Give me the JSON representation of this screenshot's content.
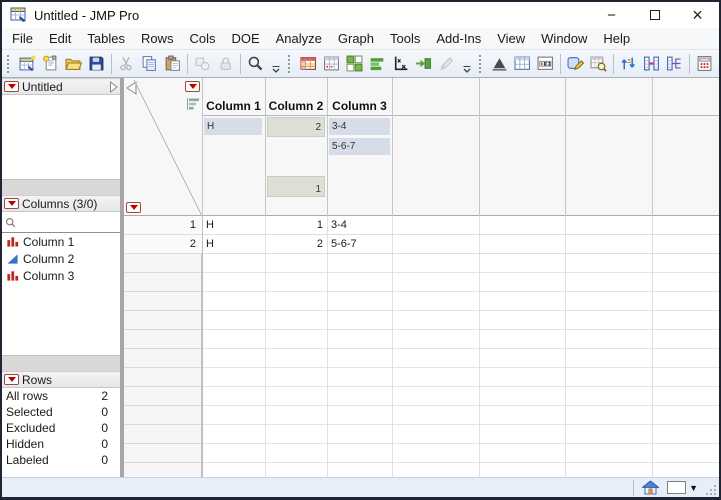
{
  "window": {
    "title": "Untitled - JMP Pro",
    "controls": {
      "minimize": "−",
      "close": "×"
    }
  },
  "menu": {
    "items": [
      "File",
      "Edit",
      "Tables",
      "Rows",
      "Cols",
      "DOE",
      "Analyze",
      "Graph",
      "Tools",
      "Add-Ins",
      "View",
      "Window",
      "Help"
    ]
  },
  "toolbar": {
    "groups": [
      {
        "items": [
          {
            "icon": "new-data-table"
          },
          {
            "icon": "new-journal"
          },
          {
            "icon": "open-file"
          },
          {
            "icon": "save"
          },
          {
            "sep": true
          },
          {
            "icon": "cut",
            "disabled": true
          },
          {
            "icon": "copy"
          },
          {
            "icon": "paste"
          },
          {
            "sep": true
          },
          {
            "icon": "selection",
            "disabled": true
          },
          {
            "icon": "lock",
            "disabled": true
          },
          {
            "sep": true
          },
          {
            "icon": "search"
          }
        ]
      },
      {
        "items": [
          {
            "icon": "data-table"
          },
          {
            "icon": "summary-table"
          },
          {
            "icon": "tile-windows"
          },
          {
            "icon": "bar-chart"
          },
          {
            "icon": "axes"
          },
          {
            "icon": "formula-run"
          },
          {
            "icon": "edit-pen",
            "disabled": true
          }
        ]
      },
      {
        "items": [
          {
            "icon": "distribution"
          },
          {
            "icon": "new-column-grid"
          },
          {
            "icon": "numeric-grid"
          },
          {
            "sep": true
          },
          {
            "icon": "select-edit"
          },
          {
            "icon": "table-preview"
          },
          {
            "sep": true
          },
          {
            "icon": "sort-arrows"
          },
          {
            "icon": "join-columns"
          },
          {
            "icon": "split-columns"
          },
          {
            "sep": true
          },
          {
            "icon": "calculator"
          },
          {
            "icon": "run-script"
          }
        ]
      }
    ]
  },
  "sidebar": {
    "table_panel": {
      "title": "Untitled"
    },
    "columns_panel": {
      "title": "Columns (3/0)",
      "items": [
        {
          "label": "Column 1",
          "type": "nominal"
        },
        {
          "label": "Column 2",
          "type": "continuous"
        },
        {
          "label": "Column 3",
          "type": "nominal"
        }
      ]
    },
    "rows_panel": {
      "title": "Rows",
      "stats": [
        {
          "label": "All rows",
          "value": "2"
        },
        {
          "label": "Selected",
          "value": "0"
        },
        {
          "label": "Excluded",
          "value": "0"
        },
        {
          "label": "Hidden",
          "value": "0"
        },
        {
          "label": "Labeled",
          "value": "0"
        }
      ]
    }
  },
  "grid": {
    "columns": [
      "Column 1",
      "Column 2",
      "Column 3"
    ],
    "header_summary": {
      "col1": [
        {
          "label": "H"
        }
      ],
      "col2": [
        {
          "label": "2"
        },
        {
          "label": "1"
        }
      ],
      "col3": [
        {
          "label": "3-4"
        },
        {
          "label": "5-6-7"
        }
      ]
    },
    "rows": [
      {
        "num": "1",
        "c1": "H",
        "c2": "1",
        "c3": "3-4"
      },
      {
        "num": "2",
        "c1": "H",
        "c2": "2",
        "c3": "5-6-7"
      }
    ]
  },
  "colors": {
    "accent_red": "#c00000",
    "categorical_bar": "#d6dce8",
    "continuous_bar": "#dbdfd6",
    "toolbar_bg": "#edf1f9",
    "status_bg": "#e8eef8"
  }
}
